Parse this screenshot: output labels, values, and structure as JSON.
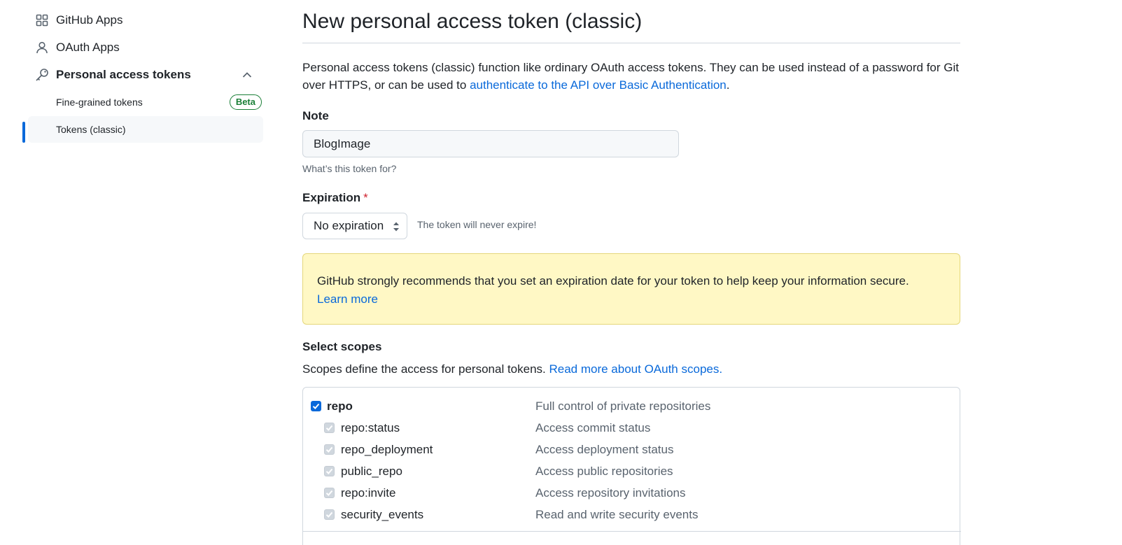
{
  "sidebar": {
    "items": [
      {
        "label": "GitHub Apps",
        "icon": "apps-grid-icon"
      },
      {
        "label": "OAuth Apps",
        "icon": "person-icon"
      },
      {
        "label": "Personal access tokens",
        "icon": "key-icon",
        "expanded": true
      }
    ],
    "subitems": [
      {
        "label": "Fine-grained tokens",
        "badge": "Beta"
      },
      {
        "label": "Tokens (classic)",
        "active": true
      }
    ]
  },
  "main": {
    "title": "New personal access token (classic)",
    "intro_text": "Personal access tokens (classic) function like ordinary OAuth access tokens. They can be used instead of a password for Git over HTTPS, or can be used to ",
    "intro_link": "authenticate to the API over Basic Authentication",
    "intro_end": ".",
    "note": {
      "label": "Note",
      "value": "BlogImage",
      "help": "What’s this token for?"
    },
    "expiration": {
      "label": "Expiration",
      "required_mark": "*",
      "selected": "No expiration",
      "note": "The token will never expire!"
    },
    "flash": {
      "text": "GitHub strongly recommends that you set an expiration date for your token to help keep your information secure.",
      "link": "Learn more"
    },
    "scopes": {
      "heading": "Select scopes",
      "desc": "Scopes define the access for personal tokens. ",
      "desc_link": "Read more about OAuth scopes.",
      "rows": [
        {
          "name": "repo",
          "desc": "Full control of private repositories",
          "checked": true,
          "child": false
        },
        {
          "name": "repo:status",
          "desc": "Access commit status",
          "checked": true,
          "child": true
        },
        {
          "name": "repo_deployment",
          "desc": "Access deployment status",
          "checked": true,
          "child": true
        },
        {
          "name": "public_repo",
          "desc": "Access public repositories",
          "checked": true,
          "child": true
        },
        {
          "name": "repo:invite",
          "desc": "Access repository invitations",
          "checked": true,
          "child": true
        },
        {
          "name": "security_events",
          "desc": "Read and write security events",
          "checked": true,
          "child": true
        }
      ]
    }
  },
  "colors": {
    "accent": "#0969da",
    "success": "#1a7f37",
    "danger": "#cf222e",
    "flash_bg": "#fff8c5"
  }
}
